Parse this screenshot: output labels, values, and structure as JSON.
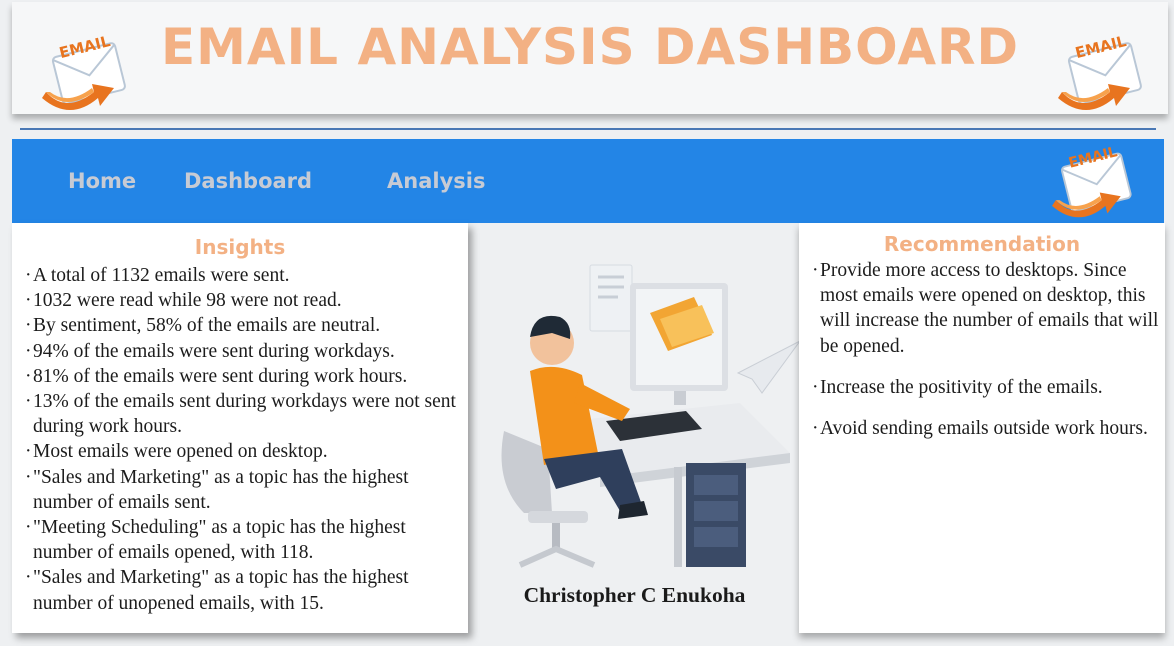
{
  "header": {
    "title": "EMAIL ANALYSIS DASHBOARD",
    "logo_text": "EMAIL"
  },
  "nav": {
    "items": [
      {
        "label": "Home"
      },
      {
        "label": "Dashboard"
      },
      {
        "label": "Analysis"
      }
    ]
  },
  "insights": {
    "heading": "Insights",
    "items": [
      "A total of 1132 emails were sent.",
      "1032 were read while 98 were not read.",
      "By sentiment, 58% of the emails are neutral.",
      "94% of the emails were sent during workdays.",
      "81% of the emails were sent during work hours.",
      "13% of the emails sent during workdays were not sent during work hours.",
      "Most emails were opened on desktop.",
      "\"Sales and Marketing\" as a topic has the highest number of emails sent.",
      "\"Meeting Scheduling\" as a topic has the highest number of emails opened, with 118.",
      "\"Sales and Marketing\" as a topic has the highest number of unopened emails, with 15."
    ]
  },
  "recommendation": {
    "heading": "Recommendation",
    "items": [
      "Provide more access to desktops. Since most emails were opened on desktop, this will increase the number of emails that will be opened.",
      "Increase the positivity of the emails.",
      "Avoid sending emails outside work hours."
    ]
  },
  "author": "Christopher C Enukoha",
  "colors": {
    "title": "#f3b184",
    "nav_bg": "#2385e6",
    "nav_text": "#c7cbd4",
    "divider": "#4a78b5"
  }
}
